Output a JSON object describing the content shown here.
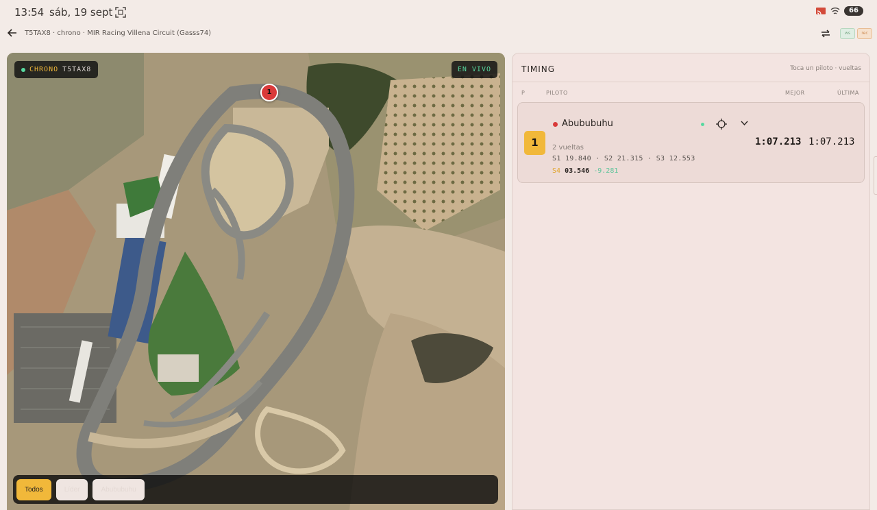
{
  "status_bar": {
    "time": "13:54",
    "date": "sáb, 19 sept",
    "battery": "66",
    "icons": [
      "screen-capture-icon",
      "cast-icon",
      "wifi-icon",
      "battery-icon"
    ]
  },
  "top_bar": {
    "breadcrumb": "T5TAX8 · chrono · MIR Racing Villena Circuit (Gasss74)",
    "pill_a": "ws",
    "pill_b": "rec"
  },
  "map": {
    "chrono_label": "CHRONO",
    "chrono_code": "T5TAX8",
    "live_label": "EN VIVO",
    "kart_marker": "1",
    "filters": [
      {
        "label": "Todos",
        "active": true
      },
      {
        "label": "Líder",
        "active": false
      },
      {
        "label": "Abububuhu",
        "active": false
      }
    ]
  },
  "timing": {
    "title": "TIMING",
    "hint": "Toca un piloto · vueltas",
    "columns": {
      "p": "P",
      "piloto": "PILOTO",
      "mejor": "MEJOR",
      "ultima": "ÚLTIMA"
    },
    "rows": [
      {
        "position": "1",
        "driver": "Abububuhu",
        "laps": "2 vueltas",
        "sectors": "S1 19.840  ·  S2 21.315  ·  S3 12.553",
        "s4_label": "S4",
        "s4_time": "03.546",
        "s4_delta": "-9.281",
        "best": "1:07.213",
        "last": "1:07.213"
      }
    ]
  },
  "colors": {
    "accent": "#f1b83a",
    "live": "#57d9a0",
    "driver": "#d93a3a",
    "background": "#f3ebe7"
  }
}
